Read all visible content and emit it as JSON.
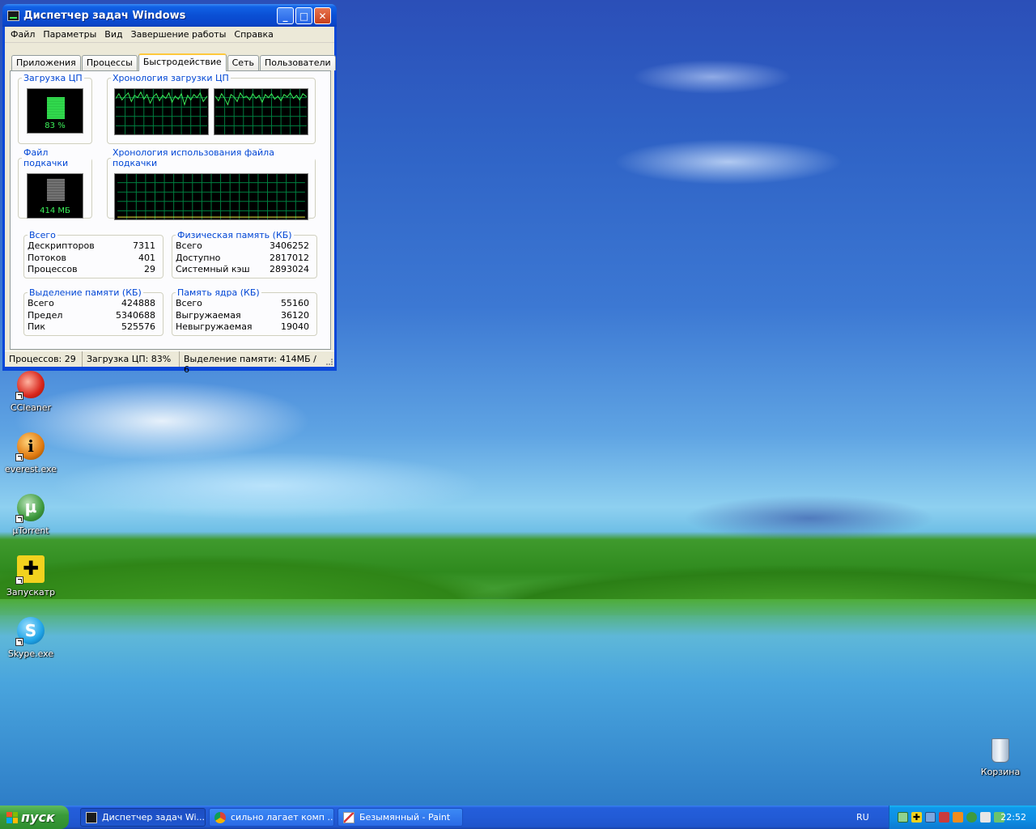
{
  "window": {
    "title": "Диспетчер задач Windows",
    "menu": [
      "Файл",
      "Параметры",
      "Вид",
      "Завершение работы",
      "Справка"
    ],
    "tabs": [
      "Приложения",
      "Процессы",
      "Быстродействие",
      "Сеть",
      "Пользователи"
    ],
    "active_tab": "Быстродействие",
    "groups": {
      "cpu_usage": {
        "label": "Загрузка ЦП",
        "value": "83 %",
        "level": 0.83
      },
      "cpu_history": {
        "label": "Хронология загрузки ЦП"
      },
      "pagefile": {
        "label": "Файл подкачки",
        "value": "414 МБ"
      },
      "pagefile_history": {
        "label": "Хронология использования файла подкачки"
      },
      "totals": {
        "label": "Всего",
        "rows": [
          {
            "name": "Дескрипторов",
            "value": "7311"
          },
          {
            "name": "Потоков",
            "value": "401"
          },
          {
            "name": "Процессов",
            "value": "29"
          }
        ]
      },
      "physical_memory": {
        "label": "Физическая память (КБ)",
        "rows": [
          {
            "name": "Всего",
            "value": "3406252"
          },
          {
            "name": "Доступно",
            "value": "2817012"
          },
          {
            "name": "Системный кэш",
            "value": "2893024"
          }
        ]
      },
      "commit_charge": {
        "label": "Выделение памяти (КБ)",
        "rows": [
          {
            "name": "Всего",
            "value": "424888"
          },
          {
            "name": "Предел",
            "value": "5340688"
          },
          {
            "name": "Пик",
            "value": "525576"
          }
        ]
      },
      "kernel_memory": {
        "label": "Память ядра (КБ)",
        "rows": [
          {
            "name": "Всего",
            "value": "55160"
          },
          {
            "name": "Выгружаемая",
            "value": "36120"
          },
          {
            "name": "Невыгружаемая",
            "value": "19040"
          }
        ]
      }
    },
    "status": {
      "processes": "Процессов: 29",
      "cpu": "Загрузка ЦП: 83%",
      "commit": "Выделение памяти: 414МБ / 6"
    }
  },
  "desktop_icons": [
    {
      "label": "CCleaner",
      "icon": "ccleaner-icon",
      "color": "#d8261c"
    },
    {
      "label": "everest.exe",
      "icon": "info-icon",
      "color": "#e07a10"
    },
    {
      "label": "µTorrent",
      "icon": "utorrent-icon",
      "color": "#3e9a3e"
    },
    {
      "label": "Запускатр",
      "icon": "launcher-icon",
      "color": "#f2d21e"
    },
    {
      "label": "Skype.exe",
      "icon": "skype-icon",
      "color": "#1fa3e6"
    }
  ],
  "recycle_bin": {
    "label": "Корзина",
    "icon": "recycle-bin-icon"
  },
  "taskbar": {
    "start_label": "пуск",
    "tasks": [
      {
        "label": "Диспетчер задач Wi...",
        "icon": "task-manager-icon",
        "active": true
      },
      {
        "label": "сильно лагает комп ...",
        "icon": "chrome-icon",
        "active": false
      },
      {
        "label": "Безымянный - Paint",
        "icon": "paint-icon",
        "active": false
      }
    ],
    "language": "RU",
    "clock": "22:52"
  }
}
